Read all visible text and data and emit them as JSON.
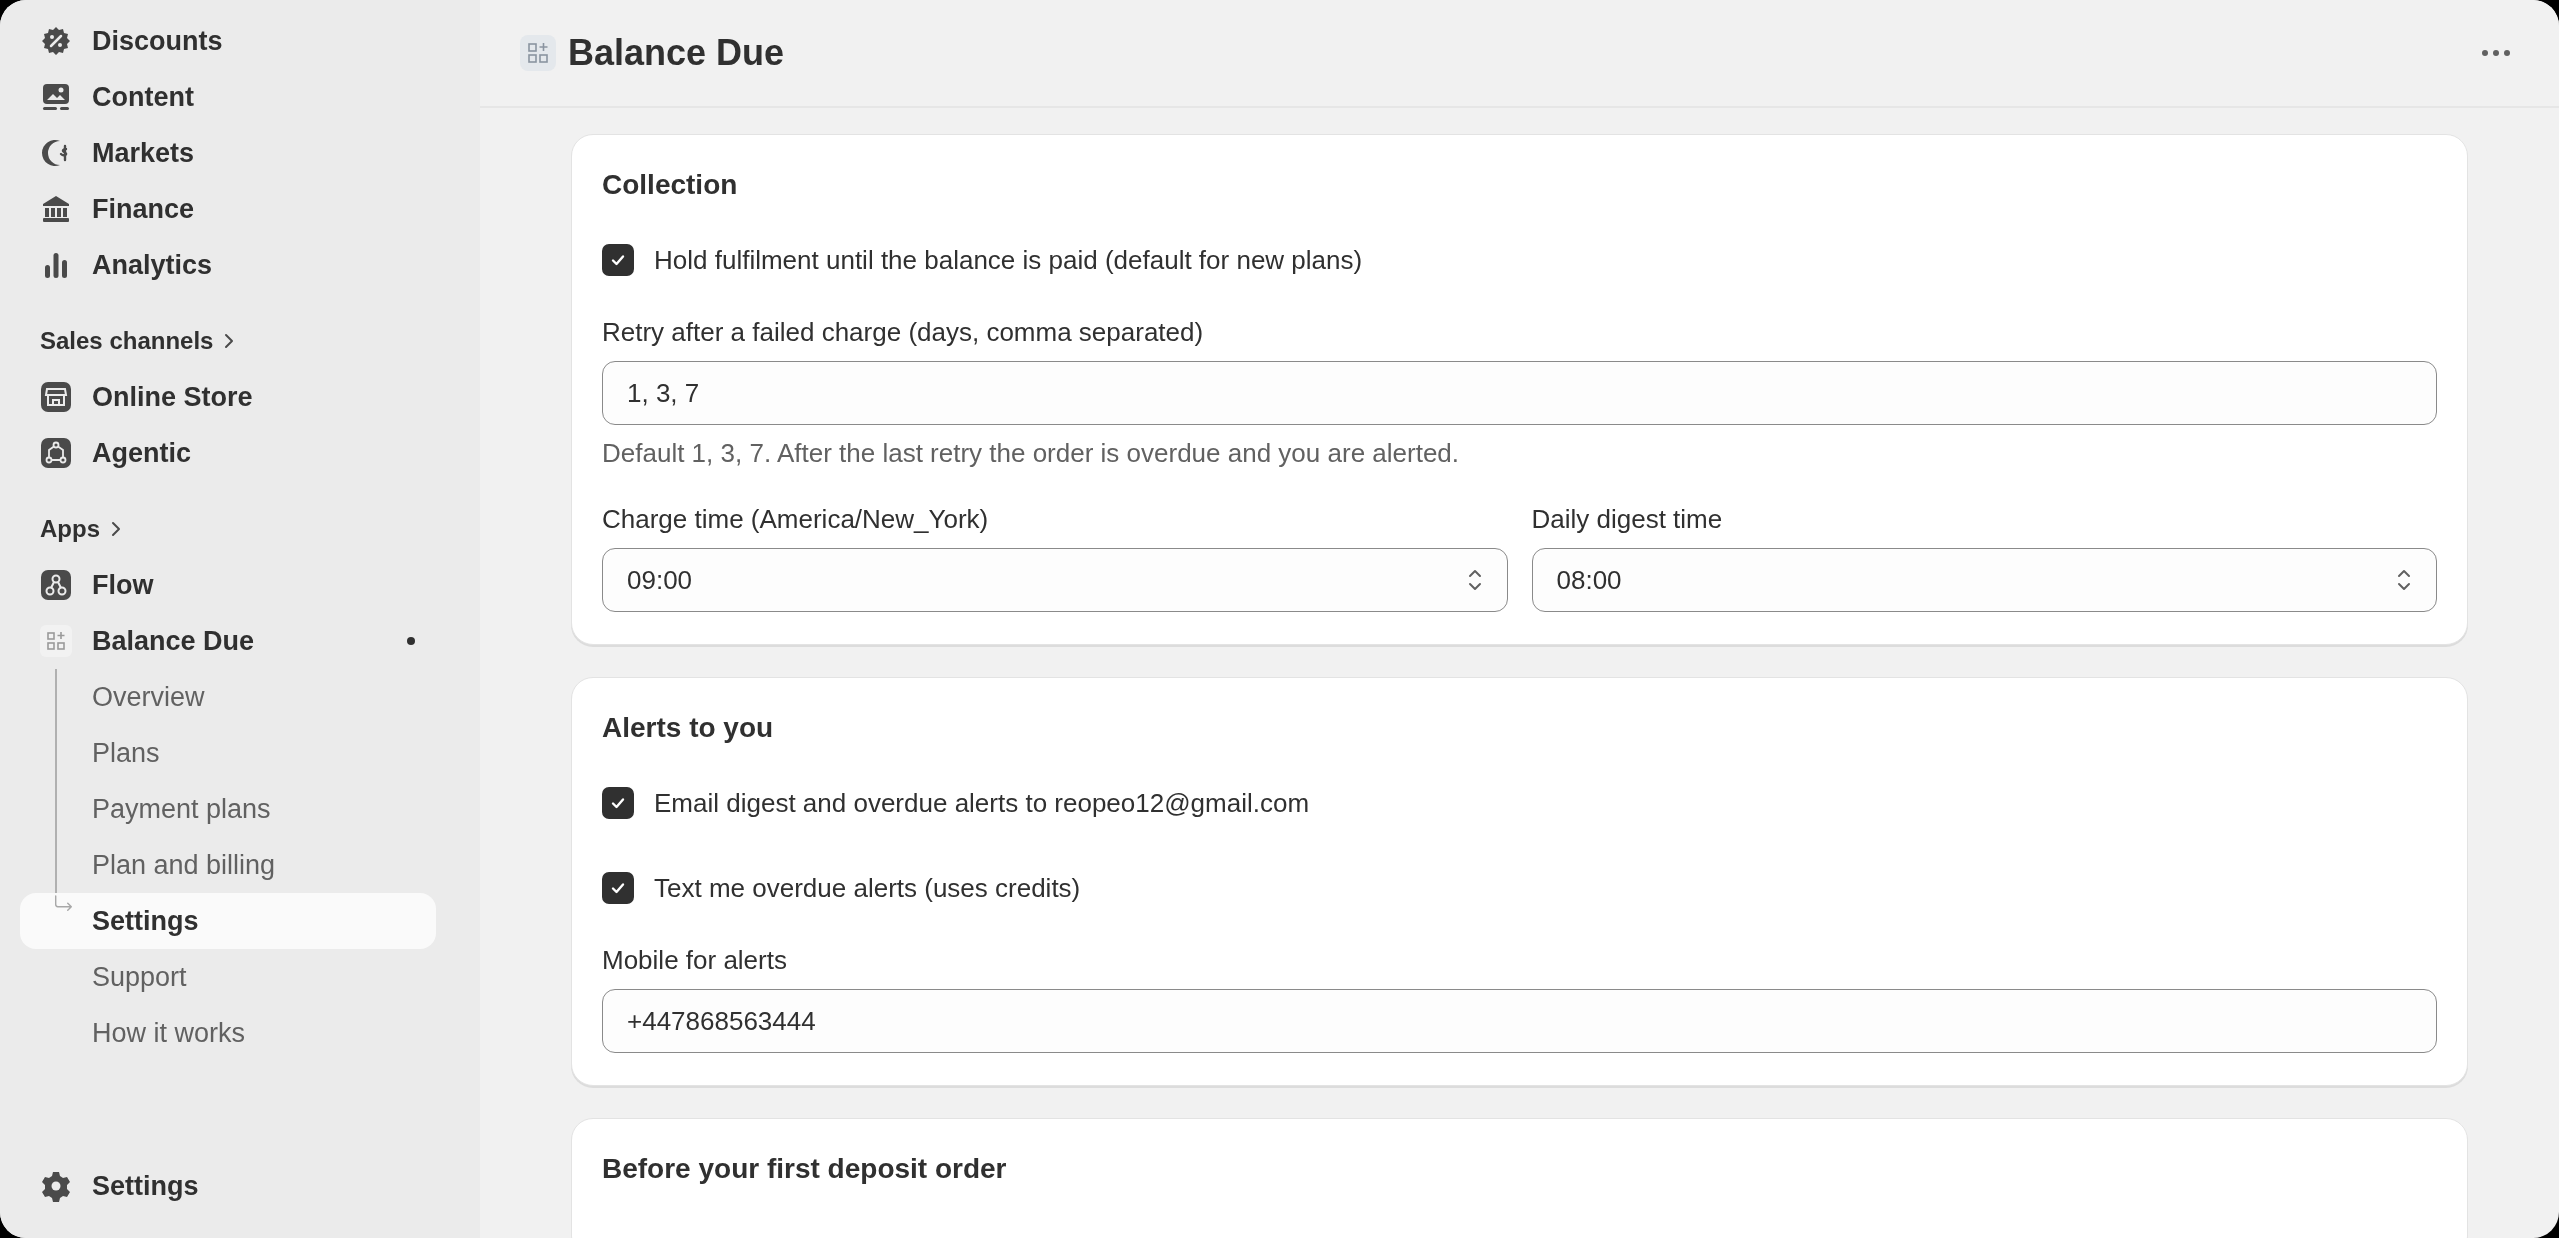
{
  "sidebar": {
    "sections": [
      {
        "items": [
          {
            "label": "Discounts"
          },
          {
            "label": "Content"
          },
          {
            "label": "Markets"
          },
          {
            "label": "Finance"
          },
          {
            "label": "Analytics"
          }
        ]
      },
      {
        "heading": "Sales channels",
        "items": [
          {
            "label": "Online Store"
          },
          {
            "label": "Agentic"
          }
        ]
      },
      {
        "heading": "Apps",
        "items": [
          {
            "label": "Flow"
          },
          {
            "label": "Balance Due",
            "children": [
              {
                "label": "Overview",
                "selected": false
              },
              {
                "label": "Plans",
                "selected": false
              },
              {
                "label": "Payment plans",
                "selected": false
              },
              {
                "label": "Plan and billing",
                "selected": false
              },
              {
                "label": "Settings",
                "selected": true
              },
              {
                "label": "Support",
                "selected": false
              },
              {
                "label": "How it works",
                "selected": false
              }
            ]
          }
        ]
      }
    ],
    "footer_item": {
      "label": "Settings"
    }
  },
  "header": {
    "title": "Balance Due"
  },
  "cards": [
    {
      "title": "Collection",
      "rows": [
        {
          "kind": "checkbox",
          "label": "Hold fulfilment until the balance is paid (default for new plans)",
          "checked": true
        },
        {
          "kind": "input",
          "label": "Retry after a failed charge (days, comma separated)",
          "value": "1, 3, 7",
          "help": "Default 1, 3, 7. After the last retry the order is overdue and you are alerted."
        },
        {
          "kind": "selects",
          "fields": [
            {
              "label": "Charge time (America/New_York)",
              "value": "09:00"
            },
            {
              "label": "Daily digest time",
              "value": "08:00"
            }
          ]
        }
      ]
    },
    {
      "title": "Alerts to you",
      "rows": [
        {
          "kind": "checkbox",
          "label": "Email digest and overdue alerts to reopeo12@gmail.com",
          "checked": true
        },
        {
          "kind": "checkbox",
          "label": "Text me overdue alerts (uses credits)",
          "checked": true
        },
        {
          "kind": "input",
          "label": "Mobile for alerts",
          "value": "+447868563444"
        }
      ]
    },
    {
      "title": "Before your first deposit order"
    }
  ]
}
